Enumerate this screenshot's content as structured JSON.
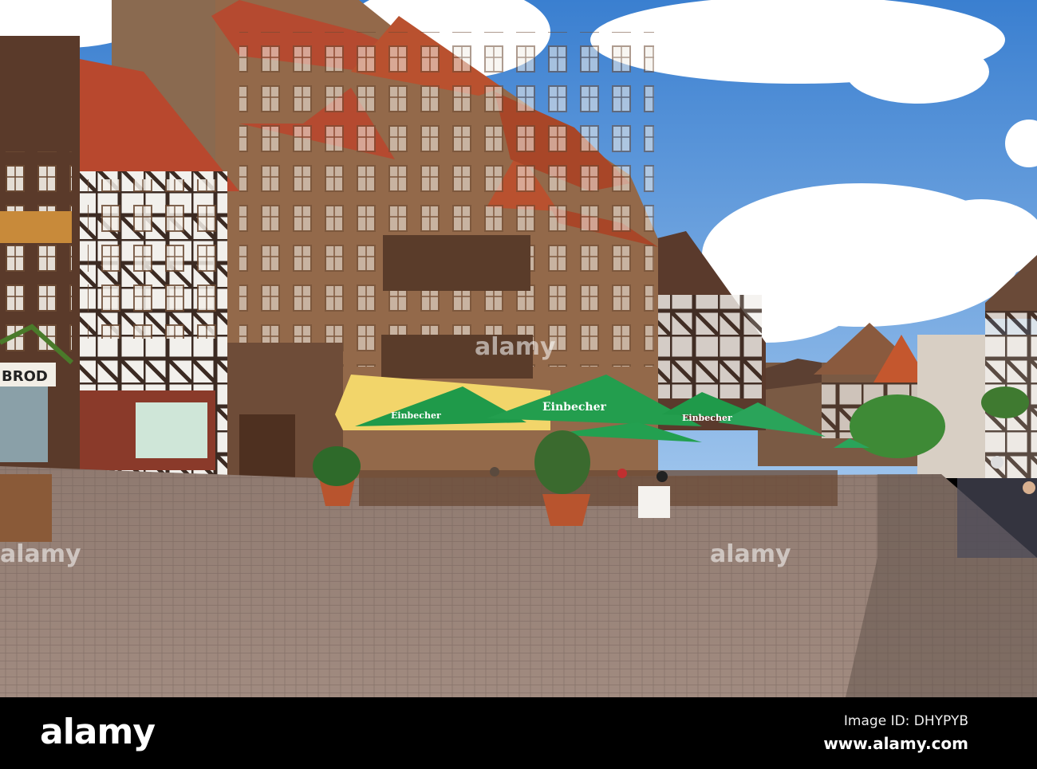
{
  "photo": {
    "description_alt": "Market square with half-timbered houses and street cafe",
    "shop_sign": "BROD",
    "umbrella_brand": "Einbecher",
    "watermark": "alamy"
  },
  "footer": {
    "logo": "alamy",
    "image_id": "Image ID: DHYPYB",
    "url": "www.alamy.com"
  },
  "colors": {
    "sky": "#4f8fd8",
    "roof": "#b8482e",
    "facade": "#8c6444",
    "umbrella": "#1f9a4a",
    "cobble": "#9a8479"
  }
}
